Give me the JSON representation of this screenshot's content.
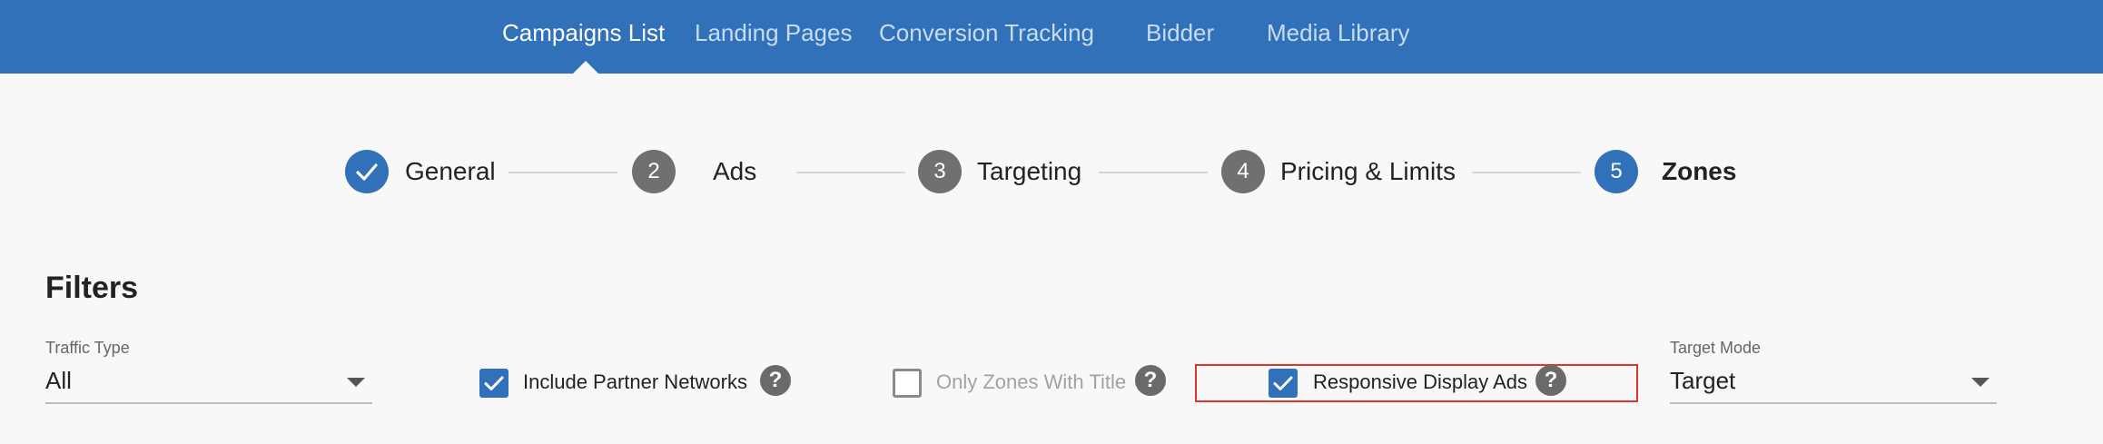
{
  "nav": {
    "items": [
      {
        "label": "Campaigns List",
        "active": true
      },
      {
        "label": "Landing Pages",
        "active": false
      },
      {
        "label": "Conversion Tracking",
        "active": false
      },
      {
        "label": "Bidder",
        "active": false
      },
      {
        "label": "Media Library",
        "active": false
      }
    ]
  },
  "stepper": {
    "steps": [
      {
        "number": "",
        "label": "General",
        "state": "completed",
        "icon": "check-icon"
      },
      {
        "number": "2",
        "label": "Ads",
        "state": "inactive"
      },
      {
        "number": "3",
        "label": "Targeting",
        "state": "inactive"
      },
      {
        "number": "4",
        "label": "Pricing & Limits",
        "state": "inactive"
      },
      {
        "number": "5",
        "label": "Zones",
        "state": "active"
      }
    ]
  },
  "filters": {
    "title": "Filters",
    "traffic_type": {
      "label": "Traffic Type",
      "value": "All"
    },
    "include_partner_networks": {
      "label": "Include Partner Networks",
      "checked": true
    },
    "only_zones_with_title": {
      "label": "Only Zones With Title",
      "checked": false
    },
    "responsive_display_ads": {
      "label": "Responsive Display Ads",
      "checked": true
    },
    "target_mode": {
      "label": "Target Mode",
      "value": "Target"
    },
    "help_glyph": "?"
  },
  "colors": {
    "brand_blue": "#3171b9",
    "step_gray": "#707070",
    "highlight_red": "#d9382b"
  }
}
